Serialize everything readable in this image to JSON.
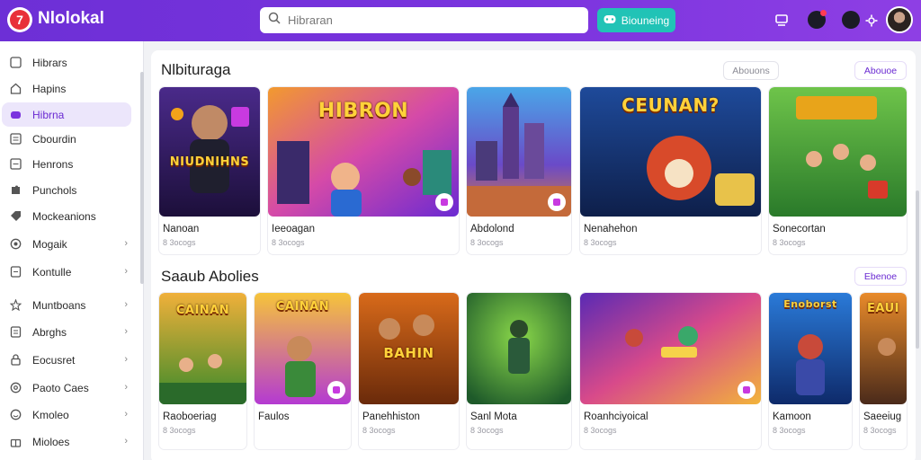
{
  "app": {
    "title": "Nlolokal"
  },
  "search": {
    "placeholder": "Hibraran"
  },
  "top_button": {
    "label": "Biouneing"
  },
  "sidebar": {
    "items": [
      {
        "label": "Hibrars",
        "icon": "square-icon"
      },
      {
        "label": "Hapins",
        "icon": "home-icon"
      },
      {
        "label": "Hibrna",
        "icon": "controller-icon"
      },
      {
        "label": "Cbourdin",
        "icon": "list-icon"
      },
      {
        "label": "Henrons",
        "icon": "list-icon"
      },
      {
        "label": "Punchols",
        "icon": "puzzle-icon"
      },
      {
        "label": "Mockeanions",
        "icon": "tag-icon"
      },
      {
        "label": "Mogaik",
        "icon": "circle-icon"
      },
      {
        "label": "Kontulle",
        "icon": "doc-icon"
      },
      {
        "label": "Muntboans",
        "icon": "star-icon"
      },
      {
        "label": "Abrghs",
        "icon": "doc-icon"
      },
      {
        "label": "Eocusret",
        "icon": "lock-icon"
      },
      {
        "label": "Paoto Caes",
        "icon": "search-icon"
      },
      {
        "label": "Kmoleo",
        "icon": "smile-icon"
      },
      {
        "label": "Mioloes",
        "icon": "gift-icon"
      }
    ]
  },
  "section1": {
    "title": "Nlbituraga",
    "filter_label": "Abouons",
    "more_label": "Abouoe",
    "cards": [
      {
        "name": "Nanoan",
        "meta": "8 3ocogs",
        "art": "NIUDNIHNS"
      },
      {
        "name": "Ieeoagan",
        "meta": "8 3ocogs",
        "art": "HIBRON"
      },
      {
        "name": "Abdolond",
        "meta": "8 3ocogs",
        "art": ""
      },
      {
        "name": "Nenahehon",
        "meta": "8 3ocogs",
        "art": "CEUNAN?"
      },
      {
        "name": "Sonecortan",
        "meta": "8 3ocogs",
        "art": ""
      }
    ]
  },
  "section2": {
    "title": "Saaub Abolies",
    "more_label": "Ebenoe",
    "cards": [
      {
        "name": "Raoboeriag",
        "meta": "8 3ocogs",
        "art": "CAINAN"
      },
      {
        "name": "Faulos",
        "meta": "",
        "art": "CAINAN"
      },
      {
        "name": "Panehhiston",
        "meta": "8 3ocogs",
        "art": "BAHIN"
      },
      {
        "name": "Sanl Mota",
        "meta": "8 3ocogs",
        "art": ""
      },
      {
        "name": "Roanhciyoical",
        "meta": "8 3ocogs",
        "art": ""
      },
      {
        "name": "Kamoon",
        "meta": "8 3ocogs",
        "art": "Enoborst"
      },
      {
        "name": "Saeeiug",
        "meta": "8 3ocogs",
        "art": "EAUI"
      }
    ]
  },
  "colors": {
    "brand": "#7a34de",
    "accent": "#21c3b6",
    "active": "#6a2ad2"
  }
}
